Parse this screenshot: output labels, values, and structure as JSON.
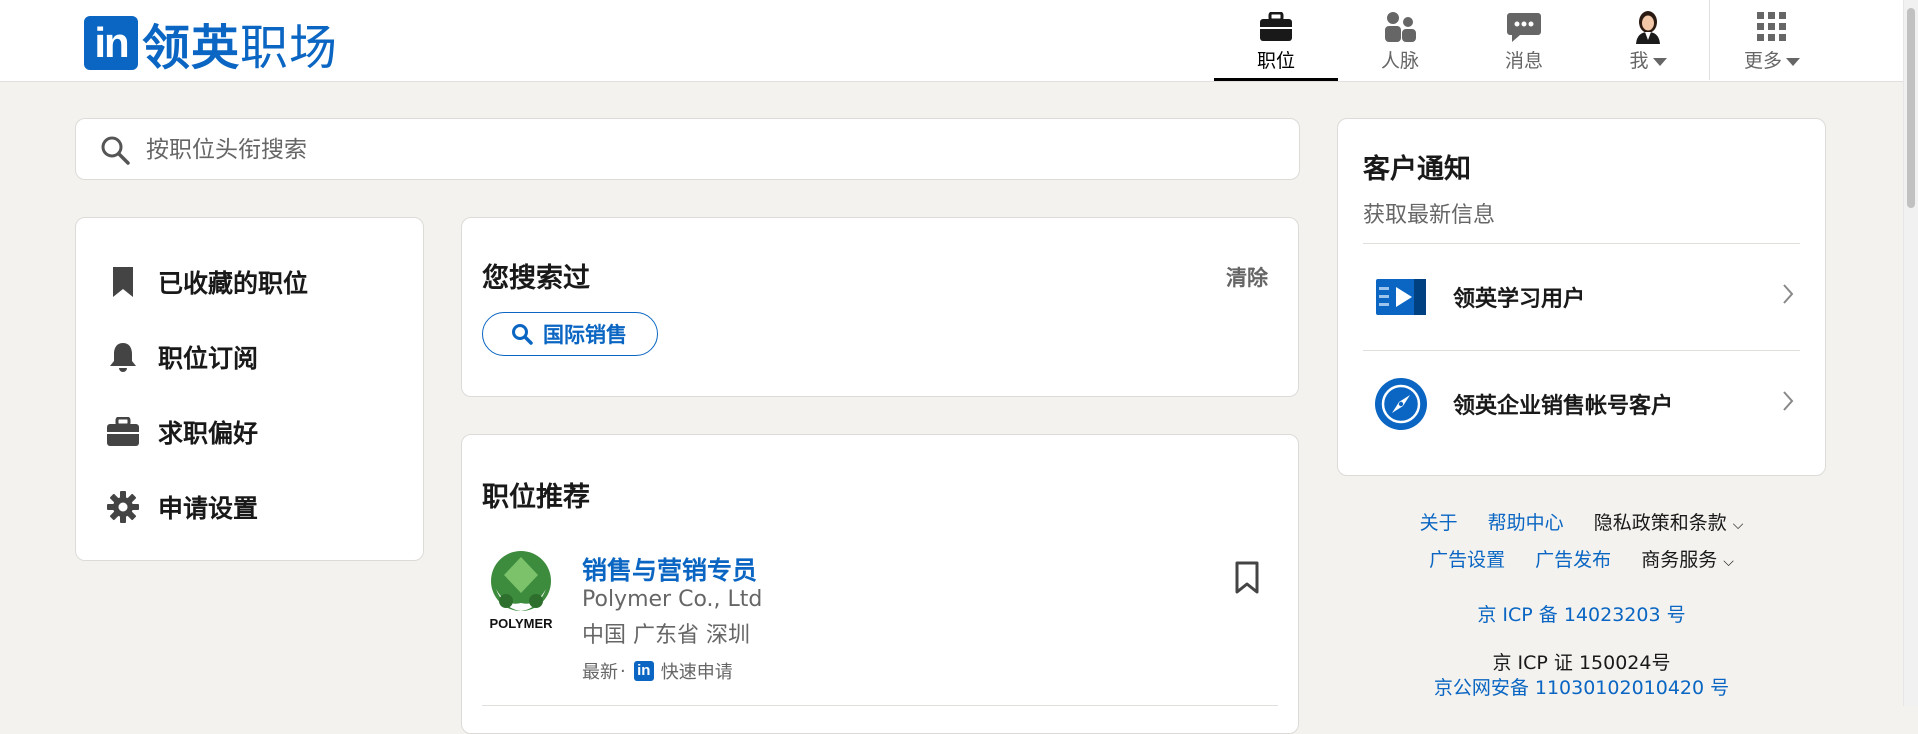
{
  "header": {
    "logo_mark": "in",
    "logo_text_bold": "领英",
    "logo_text_thin": "职场",
    "nav": [
      {
        "label": "职位",
        "icon": "briefcase-icon",
        "active": true
      },
      {
        "label": "人脉",
        "icon": "people-icon",
        "active": false
      },
      {
        "label": "消息",
        "icon": "chat-bubble-icon",
        "active": false
      },
      {
        "label": "我",
        "icon": "avatar",
        "active": false
      },
      {
        "label": "更多",
        "icon": "grid-icon",
        "active": false
      }
    ]
  },
  "search": {
    "placeholder": "按职位头衔搜索"
  },
  "left_nav": {
    "items": [
      {
        "label": "已收藏的职位",
        "icon": "bookmark-icon"
      },
      {
        "label": "职位订阅",
        "icon": "bell-icon"
      },
      {
        "label": "求职偏好",
        "icon": "briefcase-icon"
      },
      {
        "label": "申请设置",
        "icon": "gear-icon"
      }
    ]
  },
  "recent_searches": {
    "title": "您搜索过",
    "clear_label": "清除",
    "items": [
      {
        "label": "国际销售",
        "icon": "search-icon"
      }
    ]
  },
  "recommended": {
    "title": "职位推荐",
    "jobs": [
      {
        "title": "销售与营销专员",
        "company": "Polymer Co., Ltd",
        "location": "中国 广东省 深圳",
        "tag_new": "最新",
        "dot": "·",
        "easy_apply": "快速申请",
        "logo_text": "POLYMER"
      }
    ]
  },
  "notifications": {
    "title": "客户通知",
    "subtitle": "获取最新信息",
    "items": [
      {
        "label": "领英学习用户",
        "icon": "play-icon"
      },
      {
        "label": "领英企业销售帐号客户",
        "icon": "compass-icon"
      }
    ]
  },
  "footer": {
    "row1": {
      "about": "关于",
      "help": "帮助中心",
      "privacy": "隐私政策和条款"
    },
    "row2": {
      "ad_settings": "广告设置",
      "ad_publish": "广告发布",
      "business": "商务服务"
    },
    "icp1": "京 ICP 备 14023203 号",
    "icp2": "京 ICP 证 150024号",
    "icp3": "京公网安备 11030102010420 号"
  },
  "colors": {
    "brand": "#0a66c2",
    "background": "#f3f2ef"
  }
}
